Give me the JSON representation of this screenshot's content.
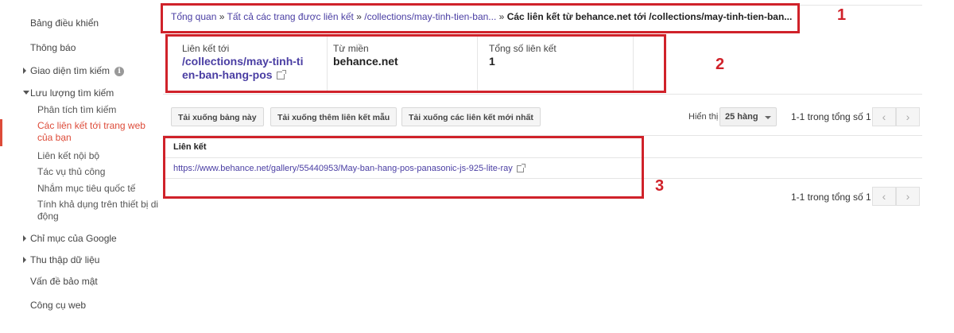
{
  "sidebar": {
    "dashboard": "Bảng điều khiển",
    "messages": "Thông báo",
    "search_appearance": "Giao diện tìm kiếm",
    "search_traffic": "Lưu lượng tìm kiếm",
    "search_traffic_items": [
      "Phân tích tìm kiếm",
      "Các liên kết tới trang web",
      "của bạn",
      "Liên kết nội bộ",
      "Tác vụ thủ công",
      "Nhắm mục tiêu quốc tế",
      "Tính khả dụng trên thiết bị di",
      "động"
    ],
    "google_index": "Chỉ mục của Google",
    "crawl": "Thu thập dữ liệu",
    "security_issues": "Vấn đề bảo mật",
    "web_tools": "Công cụ web"
  },
  "breadcrumb": {
    "overview": "Tổng quan",
    "separator": "»",
    "all_linked_pages": "Tất cả các trang được liên kết",
    "collections": "/collections/may-tinh-tien-ban...",
    "current": "Các liên kết từ behance.net tới /collections/may-tinh-tien-ban..."
  },
  "summary": {
    "target_label": "Liên kết tới",
    "target_line1": "/collections/may-tinh-ti",
    "target_line2": "en-ban-hang-pos",
    "domain_label": "Từ miền",
    "domain_value": "behance.net",
    "total_label": "Tổng số liên kết",
    "total_value": "1"
  },
  "toolbar": {
    "download_table": "Tải xuống bảng này",
    "download_more_samples": "Tải xuống thêm liên kết mẫu",
    "download_latest": "Tải xuống các liên kết mới nhất",
    "show_label": "Hiển thị",
    "rows_option": "25 hàng",
    "pager_text": "1-1 trong tổng số 1"
  },
  "table": {
    "header": "Liên kết",
    "rows": [
      "https://www.behance.net/gallery/55440953/May-ban-hang-pos-panasonic-js-925-lite-ray"
    ]
  },
  "annotations": {
    "n1": "1",
    "n2": "2",
    "n3": "3"
  },
  "colors": {
    "accent_red": "#d0222a",
    "link": "#4a3ea3",
    "active_nav": "#dd4b39"
  }
}
